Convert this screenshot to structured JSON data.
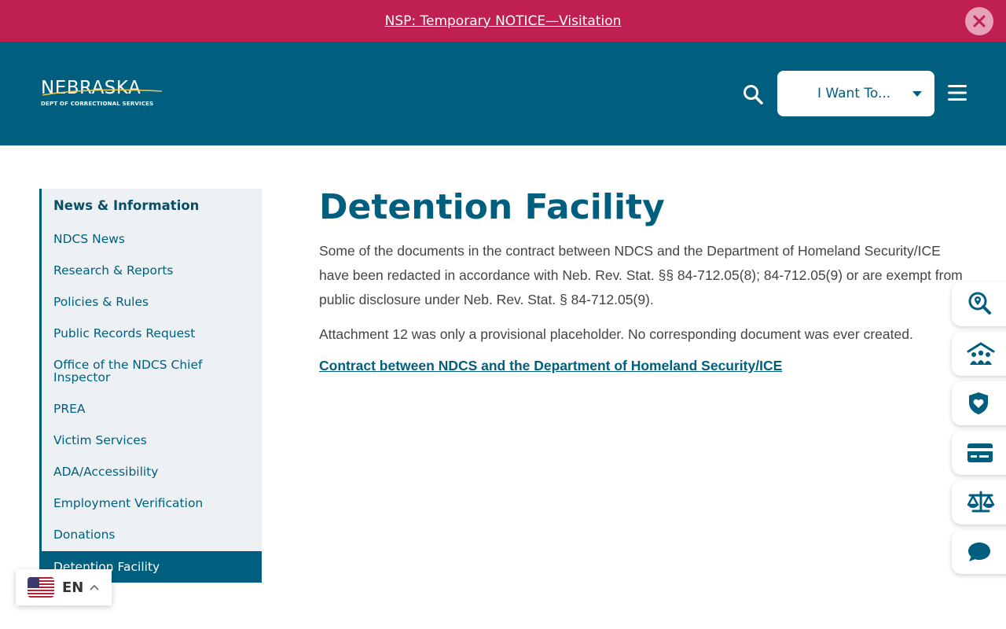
{
  "alert": {
    "text": "NSP: Temporary NOTICE—Visitation"
  },
  "header": {
    "logo_word": "NEBRASKA",
    "logo_sub": "DEPT OF CORRECTIONAL SERVICES",
    "want_label": "I Want To...",
    "colors": {
      "alert_bg": "#c01f52",
      "header_bg": "#005f7f"
    }
  },
  "sidebar": {
    "title": "News & Information",
    "items": [
      {
        "label": "NDCS News"
      },
      {
        "label": "Research & Reports"
      },
      {
        "label": "Policies & Rules"
      },
      {
        "label": "Public Records Request"
      },
      {
        "label": "Office of the NDCS Chief Inspector"
      },
      {
        "label": "PREA"
      },
      {
        "label": "Victim Services"
      },
      {
        "label": "ADA/Accessibility"
      },
      {
        "label": "Employment Verification"
      },
      {
        "label": "Donations"
      },
      {
        "label": "Detention Facility",
        "active": true
      }
    ]
  },
  "main": {
    "title": "Detention Facility",
    "paragraph1": "Some of the documents in the contract between NDCS and the Department of Homeland Security/ICE have been redacted in accordance with Neb. Rev. Stat. §§ 84-712.05(8); 84-712.05(9) or are exempt from public disclosure under Neb. Rev. Stat. § 84-712.05(9).",
    "paragraph2": "Attachment 12 was only a provisional placeholder. No corresponding document was ever created.",
    "link": "Contract between NDCS and the Department of Homeland Security/ICE"
  },
  "quick_links": [
    {
      "icon": "location-search-icon"
    },
    {
      "icon": "family-visit-icon"
    },
    {
      "icon": "heart-shield-icon"
    },
    {
      "icon": "payment-card-icon"
    },
    {
      "icon": "scales-icon"
    },
    {
      "icon": "chat-bubble-icon"
    }
  ],
  "language": {
    "code": "EN",
    "flag_icon": "us-flag-icon"
  }
}
